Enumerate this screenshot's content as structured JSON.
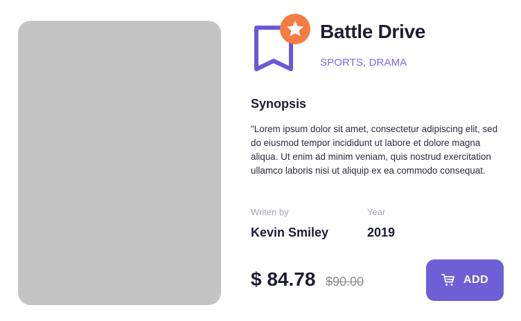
{
  "movie": {
    "title": "Battle Drive",
    "genres": "SPORTS, DRAMA"
  },
  "synopsis": {
    "heading": "Synopsis",
    "text": "\"Lorem ipsum dolor sit amet, consectetur adipiscing elit, sed do eiusmod tempor incididunt ut labore et dolore magna aliqua. Ut enim ad minim veniam, quis nostrud exercitation ullamco laboris nisi ut aliquip ex ea commodo consequat."
  },
  "meta": {
    "writer_label": "Writen by",
    "writer": "Kevin Smiley",
    "year_label": "Year",
    "year": "2019"
  },
  "pricing": {
    "price": "$ 84.78",
    "old_price": "$90.00"
  },
  "actions": {
    "add_label": "ADD"
  },
  "icons": {
    "bookmark": "bookmark-icon",
    "favorite": "star-badge-icon",
    "cart": "cart-icon"
  },
  "colors": {
    "accent": "#6f5fd6",
    "bookmark": "#6b57d9",
    "badge": "#f47c42",
    "cover_placeholder": "#c4c4c4",
    "text": "#1c1d33",
    "muted": "#a5a6b0"
  }
}
